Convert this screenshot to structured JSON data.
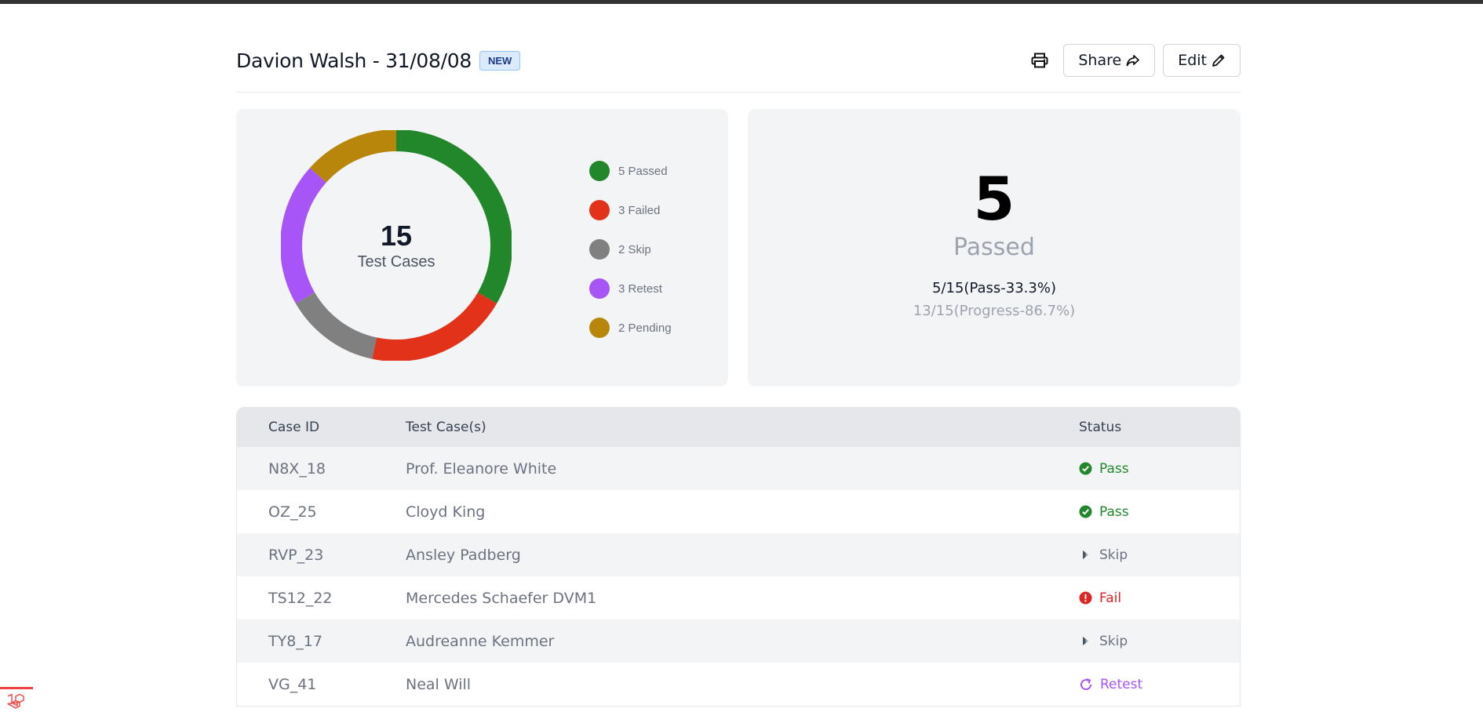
{
  "header": {
    "title": "Davion Walsh - 31/08/08",
    "badge": "NEW",
    "share_label": "Share",
    "edit_label": "Edit"
  },
  "summary": {
    "total": "15",
    "total_label": "Test Cases",
    "legend": [
      {
        "label": "5 Passed",
        "color": "#22862b",
        "value": 5
      },
      {
        "label": "3 Failed",
        "color": "#e2321a",
        "value": 3
      },
      {
        "label": "2 Skip",
        "color": "#808080",
        "value": 2
      },
      {
        "label": "3 Retest",
        "color": "#a855f7",
        "value": 3
      },
      {
        "label": "2 Pending",
        "color": "#b8860b",
        "value": 2
      }
    ],
    "passed_count": "5",
    "passed_label": "Passed",
    "pass_stat": "5/15(Pass-33.3%)",
    "progress_stat": "13/15(Progress-86.7%)"
  },
  "table": {
    "headers": {
      "case_id": "Case ID",
      "test_case": "Test Case(s)",
      "status": "Status"
    },
    "rows": [
      {
        "id": "N8X_18",
        "name": "Prof. Eleanore White",
        "status": "Pass",
        "type": "pass"
      },
      {
        "id": "OZ_25",
        "name": "Cloyd King",
        "status": "Pass",
        "type": "pass"
      },
      {
        "id": "RVP_23",
        "name": "Ansley Padberg",
        "status": "Skip",
        "type": "skip"
      },
      {
        "id": "TS12_22",
        "name": "Mercedes Schaefer DVM1",
        "status": "Fail",
        "type": "fail"
      },
      {
        "id": "TY8_17",
        "name": "Audreanne Kemmer",
        "status": "Skip",
        "type": "skip"
      },
      {
        "id": "VG_41",
        "name": "Neal Will",
        "status": "Retest",
        "type": "retest"
      }
    ]
  },
  "icons": {
    "print": "printer-icon",
    "share": "share-arrow-icon",
    "edit": "pencil-icon",
    "pass": "check-circle-icon",
    "fail": "exclamation-circle-icon",
    "skip": "skip-triangle-icon",
    "retest": "refresh-icon"
  }
}
